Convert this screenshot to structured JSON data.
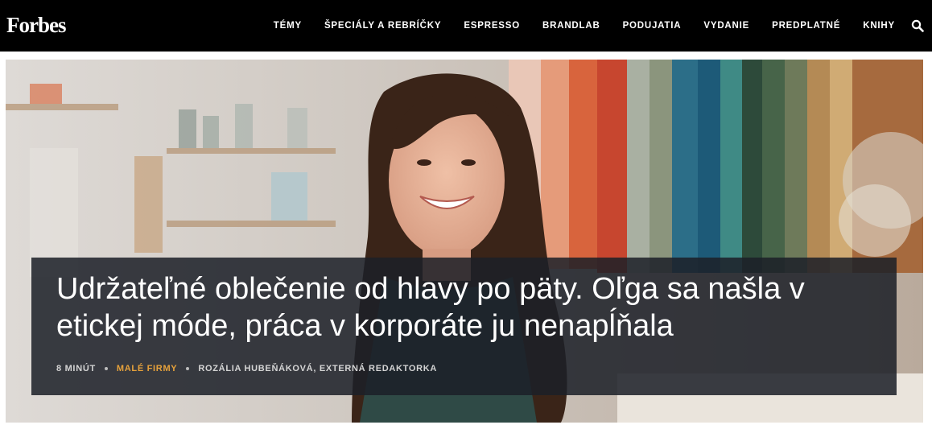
{
  "header": {
    "logo": "Forbes",
    "nav": [
      "TÉMY",
      "ŠPECIÁLY A REBRÍČKY",
      "ESPRESSO",
      "BRANDLAB",
      "PODUJATIA",
      "VYDANIE",
      "PREDPLATNÉ",
      "KNIHY"
    ],
    "search_icon": "search-icon"
  },
  "article": {
    "headline": "Udržateľné oblečenie od hlavy po päty. Oľga sa našla v etickej móde, práca v korporáte ju nenapĺňala",
    "read_time": "8 MINÚT",
    "category": "MALÉ FIRMY",
    "author": "ROZÁLIA HUBEŇÁKOVÁ, EXTERNÁ REDAKTORKA"
  },
  "colors": {
    "nav_bg": "#000000",
    "category_accent": "#e7a23b",
    "headline_box": "#1c1f28"
  }
}
